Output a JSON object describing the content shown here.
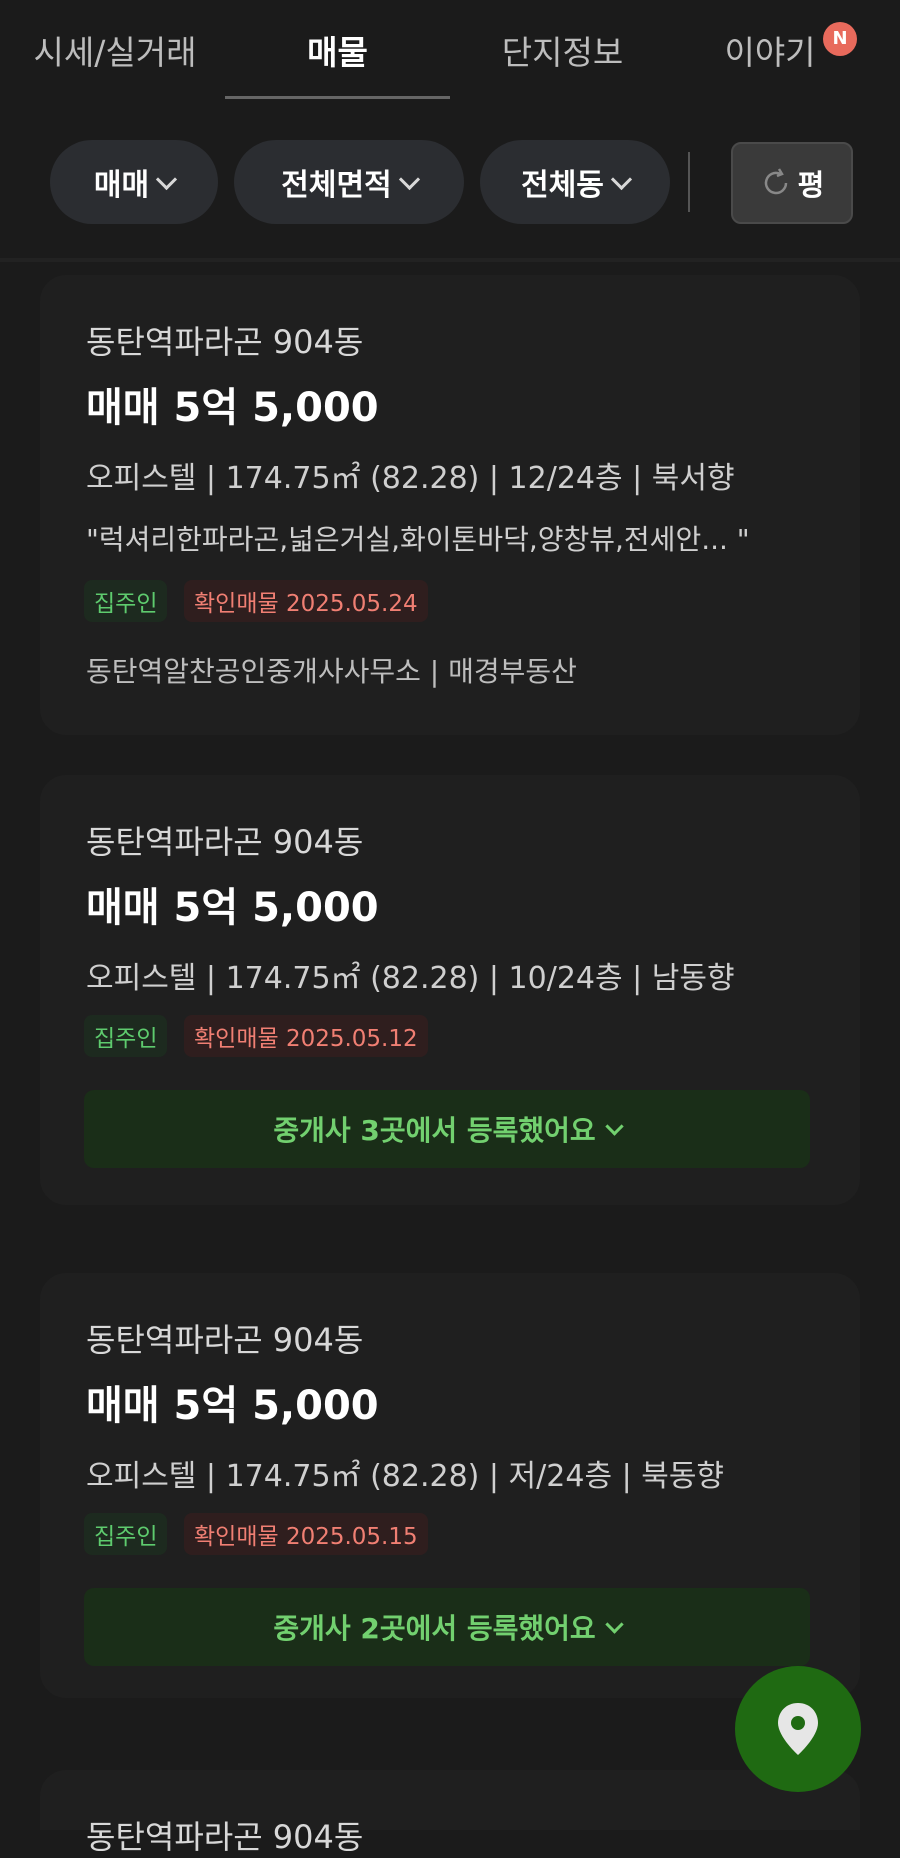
{
  "tabs": [
    {
      "label": "시세/실거래"
    },
    {
      "label": "매물"
    },
    {
      "label": "단지정보"
    },
    {
      "label": "이야기"
    }
  ],
  "tab_badge": "N",
  "filters": {
    "trade": "매매",
    "area": "전체면적",
    "dong": "전체동",
    "reset_label": "평"
  },
  "listings": [
    {
      "name": "동탄역파라곤 904동",
      "price": "매매 5억 5,000",
      "spec": "오피스텔 | 174.75㎡ (82.28) | 12/24층 | 북서향",
      "desc": "\"럭셔리한파라곤,넓은거실,화이톤바닥,양창뷰,전세안... \"",
      "tag_owner": "집주인",
      "tag_verified": "확인매물 2025.05.24",
      "agents": "동탄역알찬공인중개사사무소 | 매경부동산"
    },
    {
      "name": "동탄역파라곤 904동",
      "price": "매매 5억 5,000",
      "spec": "오피스텔 | 174.75㎡ (82.28) | 10/24층 | 남동향",
      "tag_owner": "집주인",
      "tag_verified": "확인매물 2025.05.12",
      "broker_label": "중개사 3곳에서 등록했어요"
    },
    {
      "name": "동탄역파라곤 904동",
      "price": "매매 5억 5,000",
      "spec": "오피스텔 | 174.75㎡ (82.28) | 저/24층 | 북동향",
      "tag_owner": "집주인",
      "tag_verified": "확인매물 2025.05.15",
      "broker_label": "중개사 2곳에서 등록했어요"
    },
    {
      "name": "동탄역파라곤 904동"
    }
  ],
  "icons": {
    "reset": "refresh-icon",
    "map": "map-pin-icon"
  },
  "colors": {
    "background": "#1b1b1b",
    "accent_green": "#72d06f",
    "verified_red": "#f07f73",
    "fab_green": "#1f6a12"
  }
}
